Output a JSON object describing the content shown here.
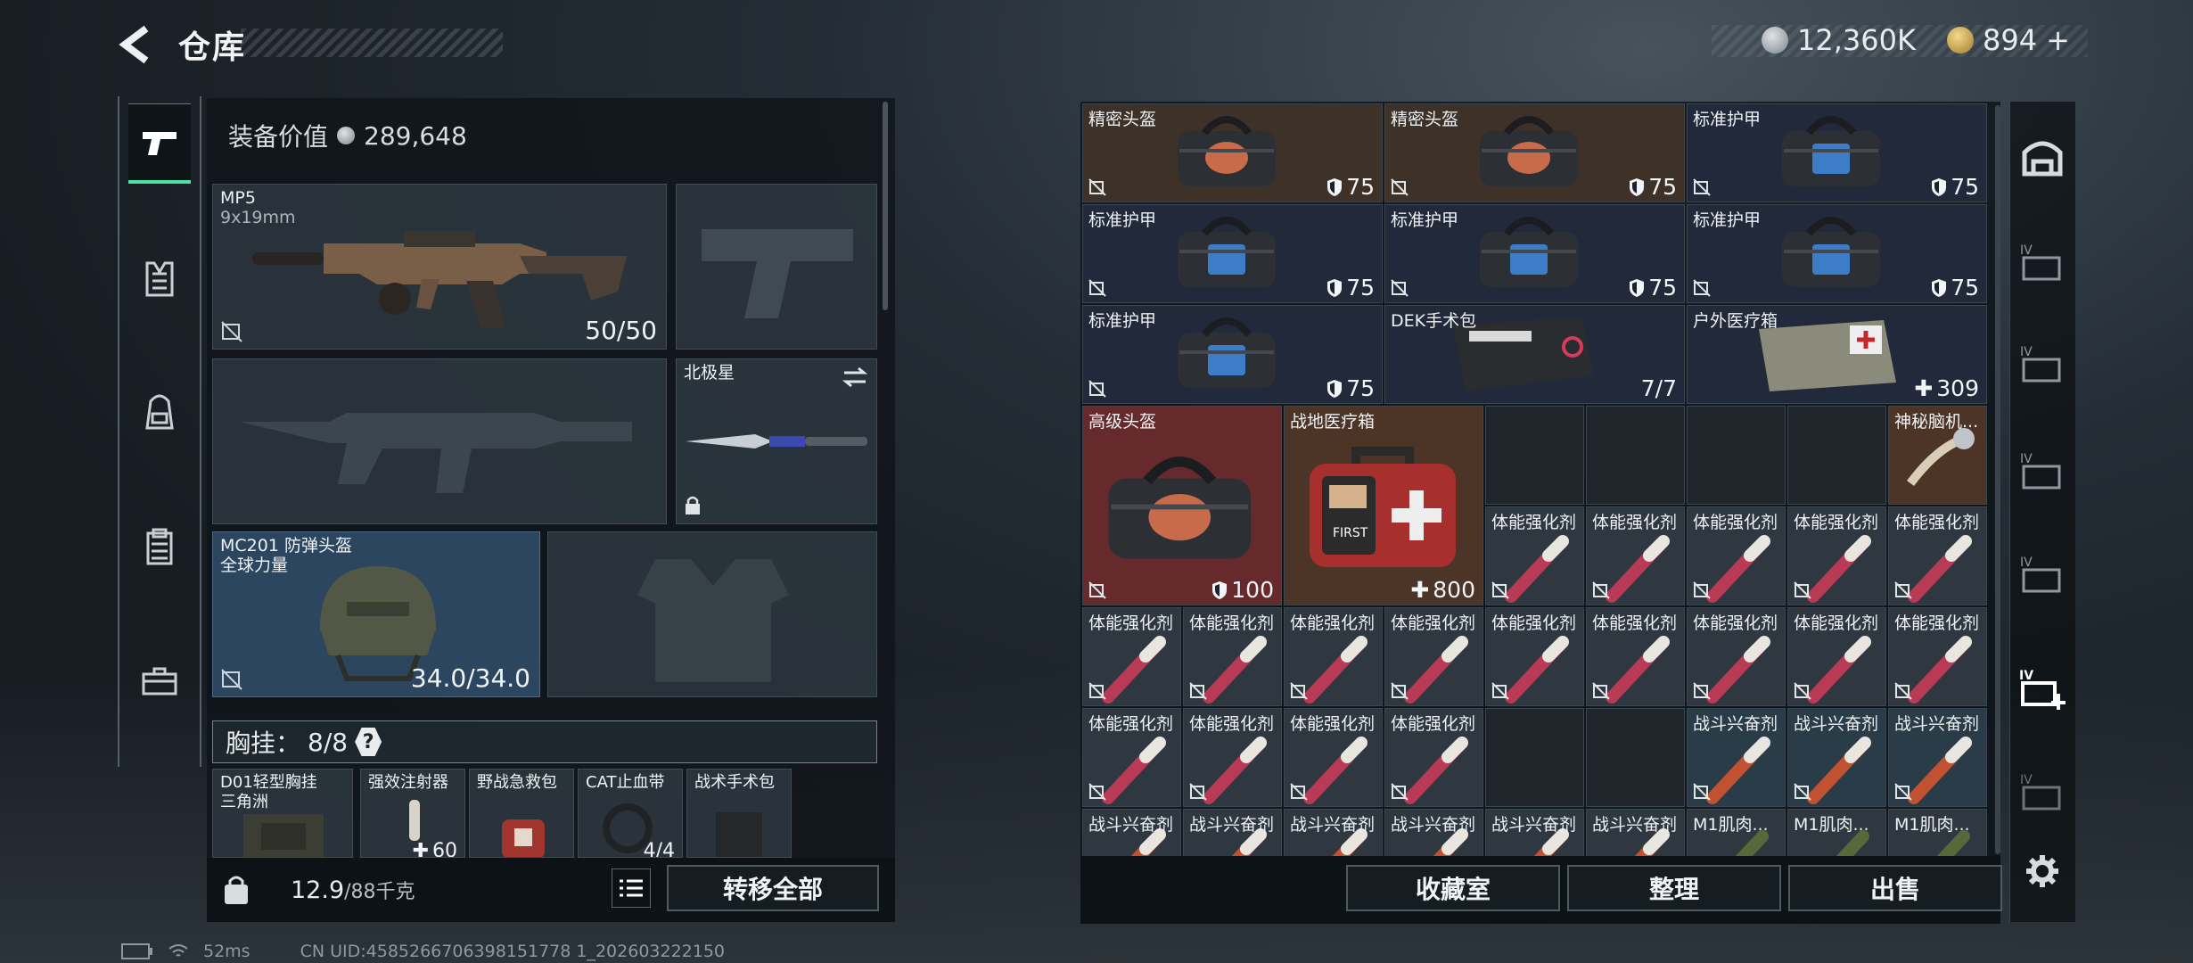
{
  "header": {
    "title": "仓库",
    "silver": "12,360K",
    "gold": "894",
    "gold_plus": "+"
  },
  "left_tabs": [
    "weapon-tab",
    "vest-tab",
    "backpack-tab",
    "clipboard-tab",
    "toolbox-tab"
  ],
  "equipment": {
    "label": "装备价值",
    "value": "289,648"
  },
  "slots": {
    "primary": {
      "name": "MP5",
      "sub": "9x19mm",
      "value": "50/50"
    },
    "melee": {
      "name": "北极星"
    },
    "helmet": {
      "name": "MC201 防弹头盔",
      "sub": "全球力量",
      "value": "34.0/34.0"
    }
  },
  "chest": {
    "label": "胸挂：",
    "value": "8/8",
    "help": "?"
  },
  "pouch": [
    {
      "name": "D01轻型胸挂",
      "sub": "三角洲"
    },
    {
      "name": "强效注射器",
      "value": "60"
    },
    {
      "name": "野战急救包"
    },
    {
      "name": "CAT止血带",
      "value": "4/4"
    },
    {
      "name": "战术手术包"
    }
  ],
  "weight": {
    "current": "12.9",
    "max": "/88千克"
  },
  "buttons": {
    "transfer": "转移全部",
    "collection": "收藏室",
    "organize": "整理",
    "sell": "出售"
  },
  "grid": [
    {
      "name": "精密头盔",
      "value": "75",
      "kind": "shield",
      "c": "c-brown",
      "img": "bag-orange"
    },
    {
      "name": "精密头盔",
      "value": "75",
      "kind": "shield",
      "c": "c-brown",
      "img": "bag-orange"
    },
    {
      "name": "标准护甲",
      "value": "75",
      "kind": "shield",
      "c": "c-navy",
      "img": "bag-blue"
    },
    {
      "name": "标准护甲",
      "value": "75",
      "kind": "shield",
      "c": "c-navy",
      "img": "bag-blue"
    },
    {
      "name": "标准护甲",
      "value": "75",
      "kind": "shield",
      "c": "c-navy",
      "img": "bag-blue"
    },
    {
      "name": "标准护甲",
      "value": "75",
      "kind": "shield",
      "c": "c-navy",
      "img": "bag-blue"
    },
    {
      "name": "标准护甲",
      "value": "75",
      "kind": "shield",
      "c": "c-navy",
      "img": "bag-blue"
    },
    {
      "name": "DEK手术包",
      "value": "7/7",
      "kind": "plain",
      "c": "c-navy",
      "img": "kit"
    },
    {
      "name": "户外医疗箱",
      "value": "309",
      "kind": "plus",
      "c": "c-navy",
      "img": "medbag"
    },
    {
      "name": "高级头盔",
      "value": "100",
      "kind": "shield",
      "c": "c-red",
      "img": "bag-orange"
    },
    {
      "name": "战地医疗箱",
      "value": "800",
      "kind": "plus",
      "c": "c-rbrown",
      "img": "firstaid"
    },
    {
      "name": "神秘脑机...",
      "value": "",
      "kind": "none",
      "c": "c-rbrown",
      "img": "device"
    }
  ],
  "stims": {
    "a": "体能强化剂",
    "b": "战斗兴奋剂",
    "c": "M1肌肉..."
  },
  "status": {
    "ping": "52ms",
    "uid": "CN UID:4585266706398151778 1_202603222150"
  }
}
